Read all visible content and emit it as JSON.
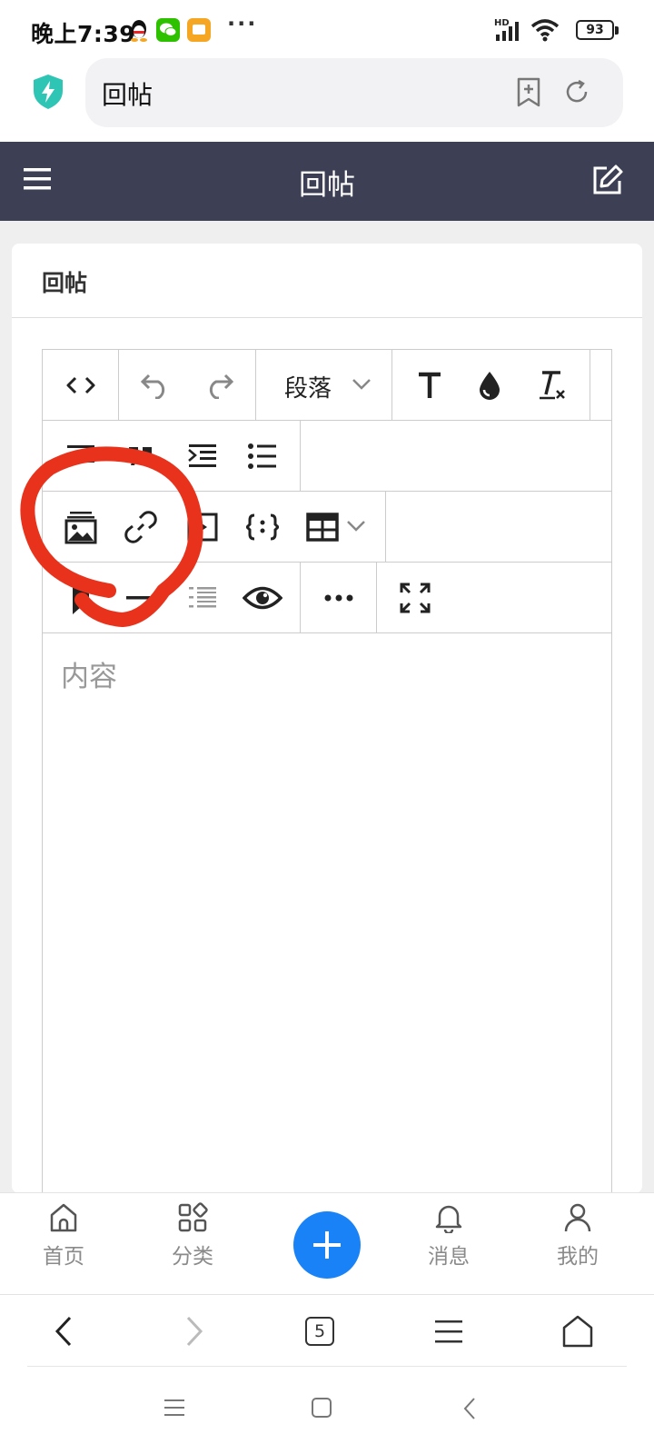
{
  "status_bar": {
    "time": "晚上7:39",
    "more": "···",
    "network": "HD",
    "battery": "93",
    "icons": [
      "qq-icon",
      "wechat-icon",
      "message-app-icon",
      "signal-icon",
      "wifi-icon",
      "battery-icon"
    ]
  },
  "browser": {
    "address_text": "回帖",
    "icons": [
      "shield-lightning-icon",
      "bookmark-add-icon",
      "refresh-icon"
    ]
  },
  "header": {
    "title": "回帖",
    "icons": [
      "hamburger-menu-icon",
      "edit-icon"
    ]
  },
  "card": {
    "title": "回帖"
  },
  "editor": {
    "block_format": "段落",
    "content_placeholder": "内容",
    "toolbar": [
      [
        "code-view",
        "undo",
        "redo",
        "block-format",
        "font-size",
        "text-color",
        "clear-format"
      ],
      [
        "align",
        "blockquote",
        "indent",
        "bullet-list"
      ],
      [
        "insert-image",
        "insert-link",
        "insert-video",
        "code-block",
        "insert-table"
      ],
      [
        "bookmark",
        "horizontal-rule",
        "ordered-list",
        "preview",
        "more",
        "fullscreen"
      ]
    ]
  },
  "app_nav": {
    "items": [
      {
        "label": "首页",
        "icon": "home-icon"
      },
      {
        "label": "分类",
        "icon": "category-grid-icon"
      },
      {
        "label": "",
        "icon": "plus-icon"
      },
      {
        "label": "消息",
        "icon": "bell-icon"
      },
      {
        "label": "我的",
        "icon": "user-icon"
      }
    ]
  },
  "browser_nav": {
    "tab_count": "5",
    "icons": [
      "back-icon",
      "forward-icon",
      "tabs-icon",
      "menu-icon",
      "home-icon"
    ]
  },
  "colors": {
    "header_bg": "#3d4054",
    "accent": "#1a82f7",
    "annotation": "#e8321c",
    "shield": "#2ec5b5"
  }
}
